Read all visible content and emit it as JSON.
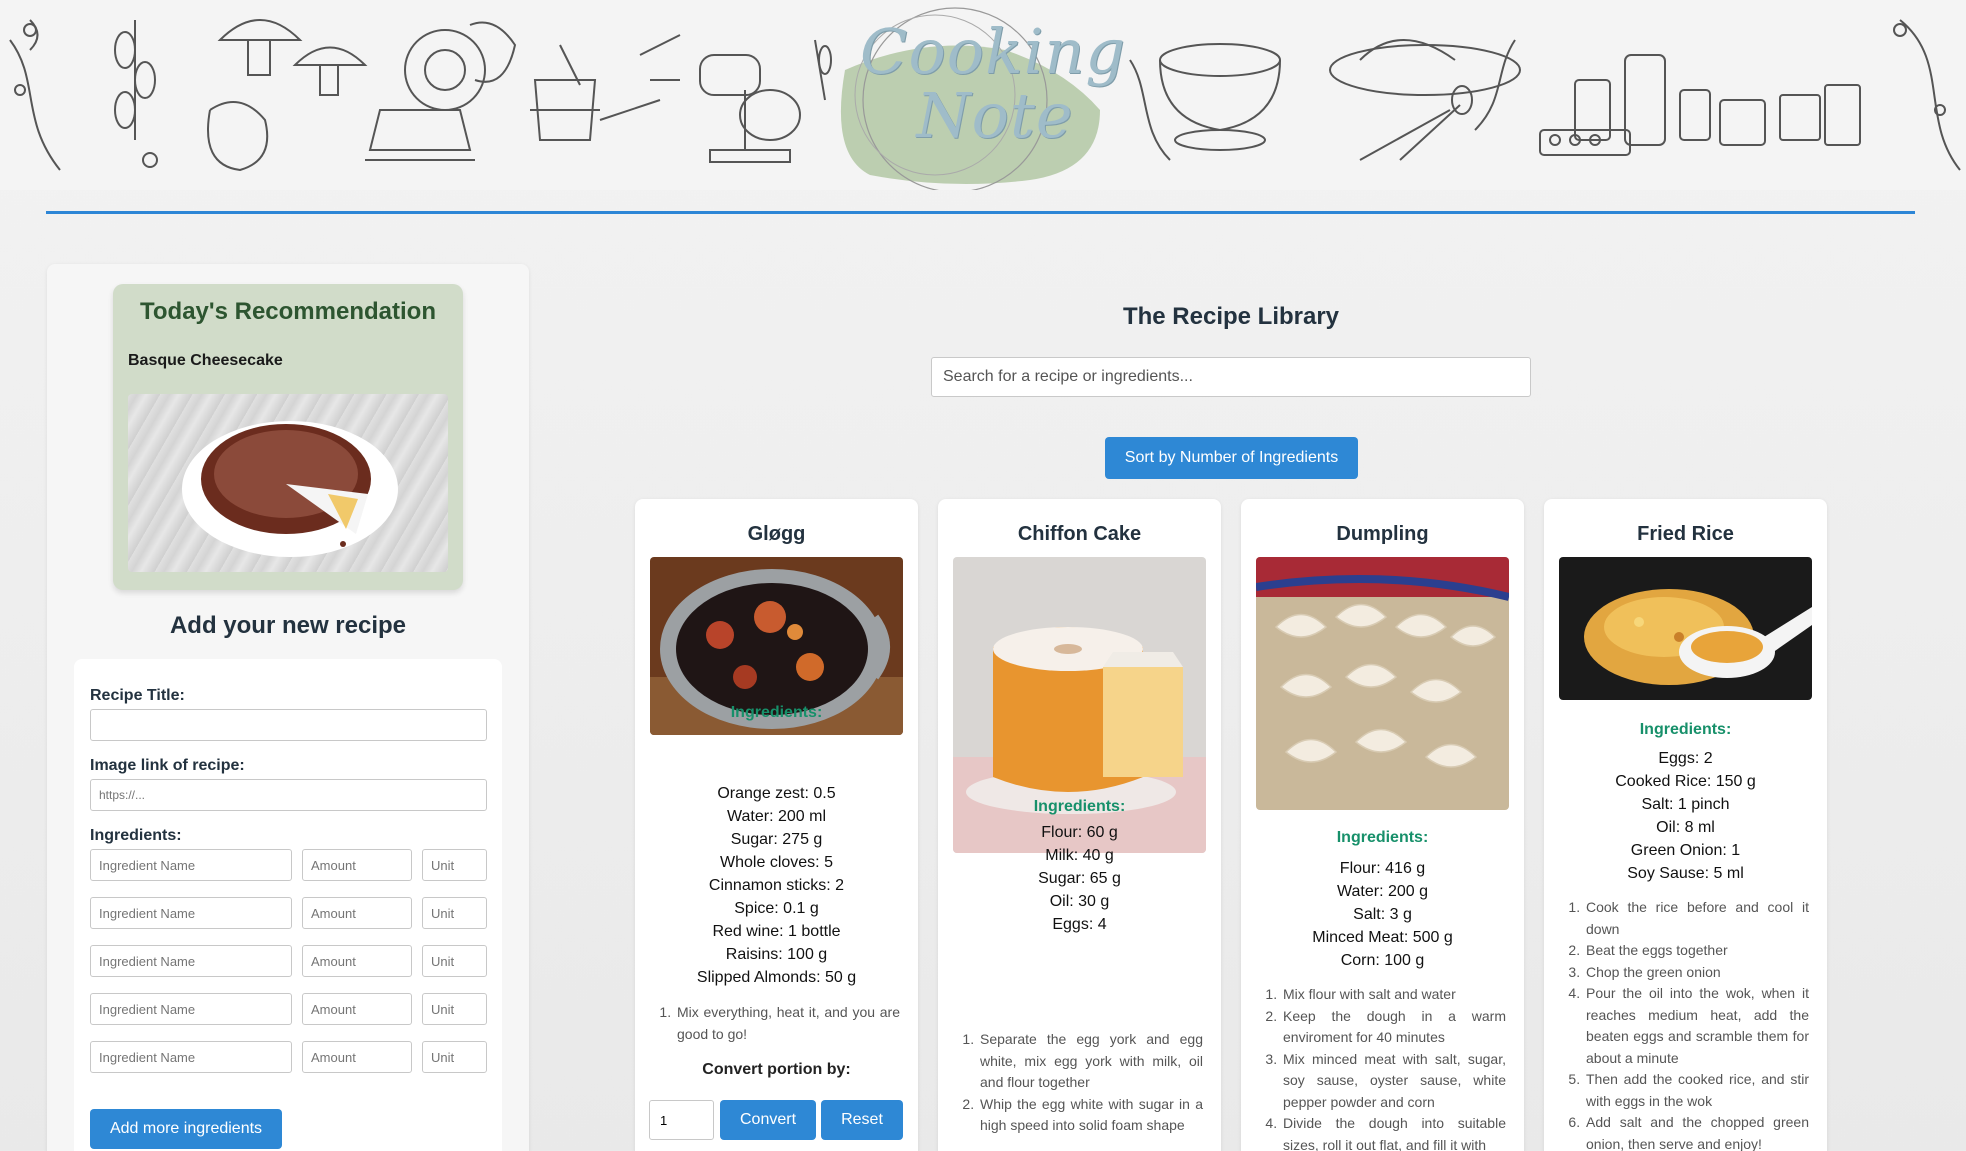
{
  "banner": {
    "logo_line1": "Cooking",
    "logo_line2": "Note"
  },
  "recommendation": {
    "title": "Today's Recommendation",
    "recipe_name": "Basque Cheesecake"
  },
  "add_recipe": {
    "title": "Add your new recipe",
    "recipe_title_label": "Recipe Title:",
    "recipe_title_value": "",
    "image_link_label": "Image link of recipe:",
    "image_link_placeholder": "https://...",
    "ingredients_label": "Ingredients:",
    "ingredient_name_placeholder": "Ingredient Name",
    "amount_placeholder": "Amount",
    "unit_placeholder": "Unit",
    "add_more_label": "Add more ingredients"
  },
  "library": {
    "title": "The Recipe Library",
    "search_placeholder": "Search for a recipe or ingredients...",
    "sort_label": "Sort by Number of Ingredients",
    "ingredients_heading": "Ingredients:",
    "convert_label": "Convert portion by:",
    "convert_value": "1",
    "convert_button": "Convert",
    "reset_button": "Reset"
  },
  "recipes": [
    {
      "title": "Gløgg",
      "ingredients": [
        "Orange zest: 0.5",
        "Water: 200 ml",
        "Sugar: 275 g",
        "Whole cloves: 5",
        "Cinnamon sticks: 2",
        "Spice: 0.1 g",
        "Red wine: 1 bottle",
        "Raisins: 100 g",
        "Slipped Almonds: 50 g"
      ],
      "steps": [
        "Mix everything, heat it, and you are good to go!"
      ]
    },
    {
      "title": "Chiffon Cake",
      "ingredients": [
        "Flour: 60 g",
        "Milk: 40 g",
        "Sugar: 65 g",
        "Oil: 30 g",
        "Eggs: 4"
      ],
      "steps": [
        "Separate the egg york and egg white, mix egg york with milk, oil and flour together",
        "Whip the egg white with sugar in a high speed into solid foam shape"
      ]
    },
    {
      "title": "Dumpling",
      "ingredients": [
        "Flour: 416 g",
        "Water: 200 g",
        "Salt: 3 g",
        "Minced Meat: 500 g",
        "Corn: 100 g"
      ],
      "steps": [
        "Mix flour with salt and water",
        "Keep the dough in a warm enviroment for 40 minutes",
        "Mix minced meat with salt, sugar, soy sause, oyster sause, white pepper powder and corn",
        "Divide the dough into suitable sizes, roll it out flat, and fill it with"
      ]
    },
    {
      "title": "Fried Rice",
      "ingredients": [
        "Eggs: 2",
        "Cooked Rice: 150 g",
        "Salt: 1 pinch",
        "Oil: 8 ml",
        "Green Onion: 1",
        "Soy Sause: 5 ml"
      ],
      "steps": [
        "Cook the rice before and cool it down",
        "Beat the eggs together",
        "Chop the green onion",
        "Pour the oil into the wok, when it reaches medium heat, add the beaten eggs and scramble them for about a minute",
        "Then add the cooked rice, and stir with eggs in the wok",
        "Add salt and the chopped green onion, then serve and enjoy!"
      ]
    }
  ]
}
